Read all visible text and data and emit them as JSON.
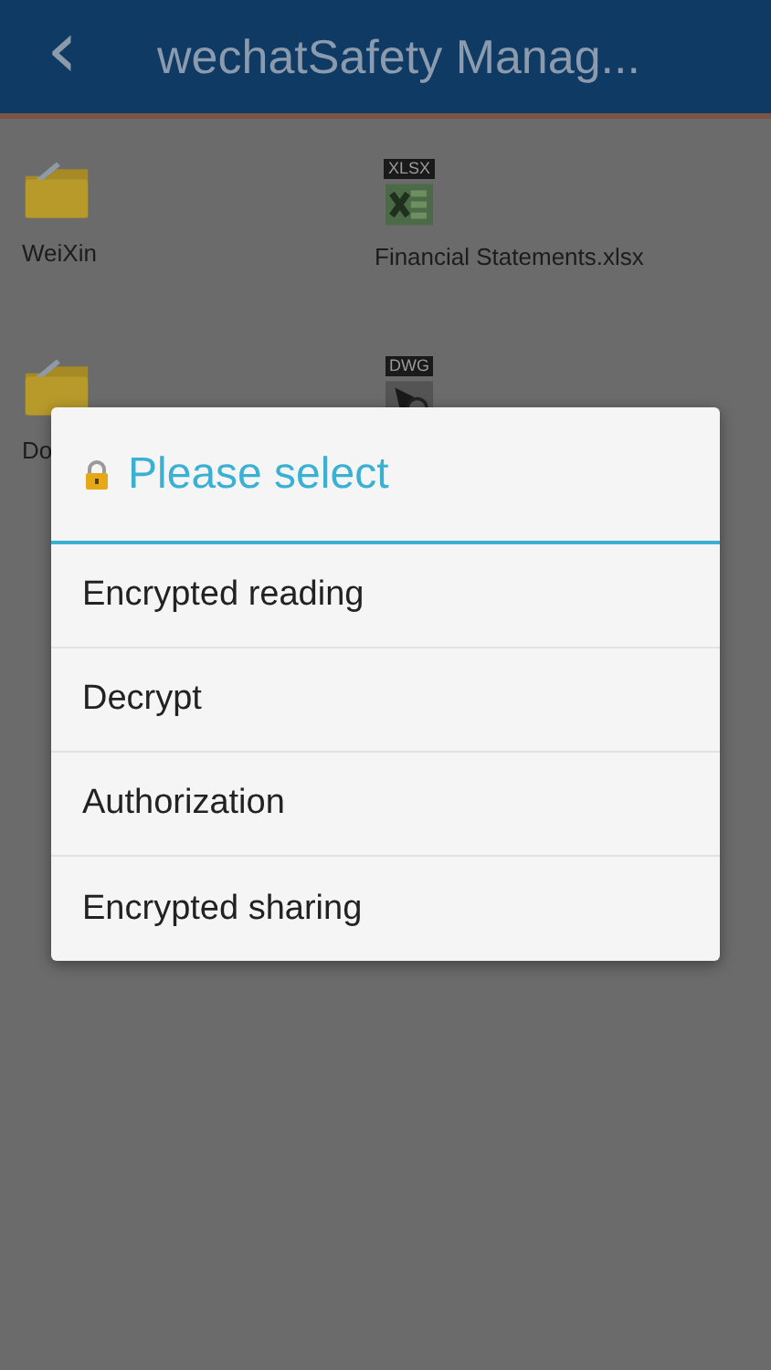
{
  "header": {
    "back_icon": "‹",
    "title": "wechatSafety Manag..."
  },
  "files": [
    {
      "kind": "folder",
      "name": "WeiXin"
    },
    {
      "kind": "xlsx",
      "badge": "XLSX",
      "name": "Financial Statements.xlsx"
    },
    {
      "kind": "folder",
      "name": "Do"
    },
    {
      "kind": "dwg",
      "badge": "DWG"
    }
  ],
  "dialog": {
    "title": "Please select",
    "options": [
      "Encrypted reading",
      "Decrypt",
      "Authorization",
      "Encrypted sharing"
    ]
  }
}
